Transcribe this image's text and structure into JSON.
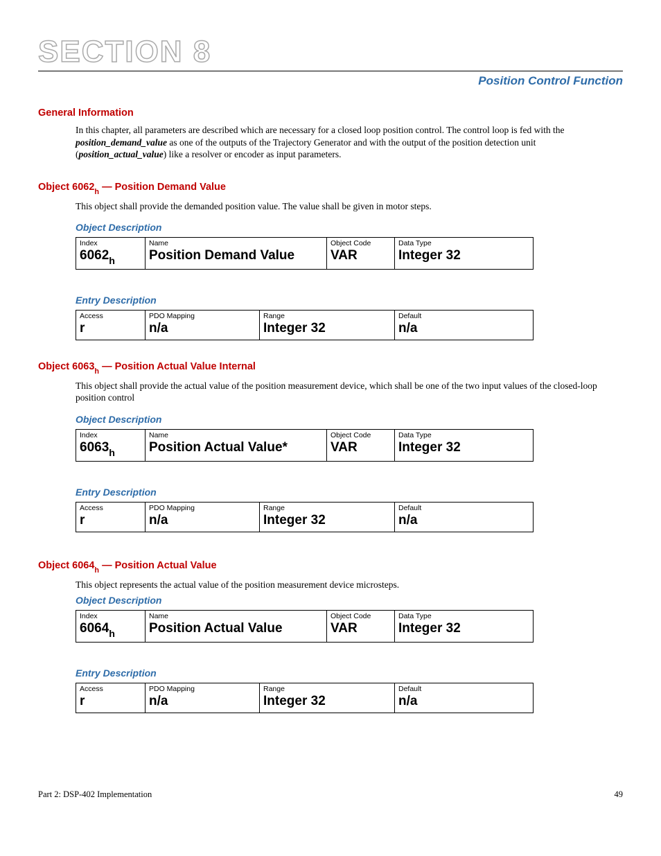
{
  "section_label": "SECTION 8",
  "page_title": "Position Control Function",
  "general_header": "General Information",
  "general_body_pre": "In this chapter, all parameters are described which are necessary for a closed loop position control. The control loop is fed with the ",
  "general_body_em1": "position_demand_value",
  "general_body_mid": " as one of the outputs of the Trajectory Generator and with the output of the position detection unit (",
  "general_body_em2": "position_actual_value",
  "general_body_post": ") like a resolver or encoder as input parameters.",
  "objects": [
    {
      "header_prefix": "Object 6062",
      "header_suffix": " — Position Demand Value",
      "body": "This object shall provide the demanded position value. The value shall be given in motor steps.",
      "obj_desc_label": "Object Description",
      "obj_desc": {
        "index_h": "Index",
        "index_v": "6062",
        "name_h": "Name",
        "name_v": "Position Demand Value",
        "code_h": "Object Code",
        "code_v": "VAR",
        "type_h": "Data Type",
        "type_v": "Integer 32"
      },
      "entry_desc_label": "Entry Description",
      "entry_desc": {
        "access_h": "Access",
        "access_v": "r",
        "pdo_h": "PDO Mapping",
        "pdo_v": "n/a",
        "range_h": "Range",
        "range_v": "Integer 32",
        "default_h": "Default",
        "default_v": "n/a"
      }
    },
    {
      "header_prefix": "Object 6063",
      "header_suffix": " — Position Actual Value Internal",
      "body": "This object shall provide the actual value of the position measurement device, which shall be one of the two input values of the closed-loop position control",
      "obj_desc_label": "Object Description",
      "obj_desc": {
        "index_h": "Index",
        "index_v": "6063",
        "name_h": "Name",
        "name_v": "Position Actual Value*",
        "code_h": "Object Code",
        "code_v": "VAR",
        "type_h": "Data Type",
        "type_v": "Integer 32"
      },
      "entry_desc_label": "Entry Description",
      "entry_desc": {
        "access_h": "Access",
        "access_v": "r",
        "pdo_h": "PDO Mapping",
        "pdo_v": "n/a",
        "range_h": "Range",
        "range_v": "Integer 32",
        "default_h": "Default",
        "default_v": "n/a"
      }
    },
    {
      "header_prefix": "Object 6064",
      "header_suffix": " — Position Actual Value",
      "body": "This object represents the actual value of the position measurement device microsteps.",
      "obj_desc_label": "Object Description",
      "obj_desc": {
        "index_h": "Index",
        "index_v": "6064",
        "name_h": "Name",
        "name_v": "Position Actual Value",
        "code_h": "Object Code",
        "code_v": "VAR",
        "type_h": "Data Type",
        "type_v": "Integer 32"
      },
      "entry_desc_label": "Entry Description",
      "entry_desc": {
        "access_h": "Access",
        "access_v": "r",
        "pdo_h": "PDO Mapping",
        "pdo_v": "n/a",
        "range_h": "Range",
        "range_v": "Integer 32",
        "default_h": "Default",
        "default_v": "n/a"
      }
    }
  ],
  "footer_left": "Part 2: DSP-402 Implementation",
  "footer_right": "49"
}
